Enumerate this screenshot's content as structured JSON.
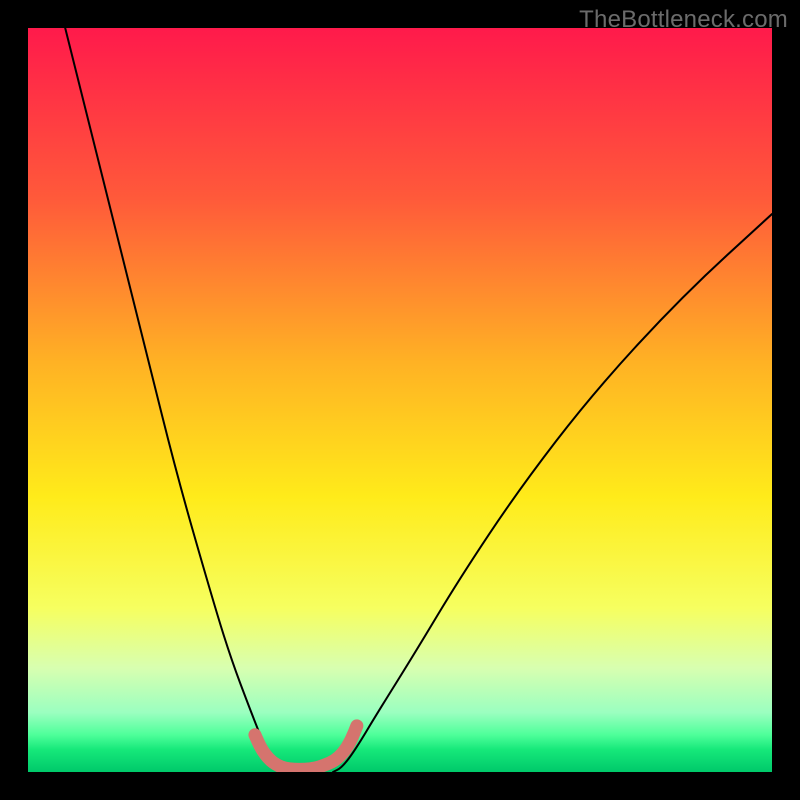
{
  "watermark": "TheBottleneck.com",
  "chart_data": {
    "type": "line",
    "title": "",
    "xlabel": "",
    "ylabel": "",
    "xlim": [
      0,
      100
    ],
    "ylim": [
      0,
      100
    ],
    "grid": false,
    "legend": false,
    "gradient_stops": [
      {
        "offset": 0.0,
        "color": "#ff1a4b"
      },
      {
        "offset": 0.23,
        "color": "#ff5a3a"
      },
      {
        "offset": 0.45,
        "color": "#ffb224"
      },
      {
        "offset": 0.63,
        "color": "#ffeb1a"
      },
      {
        "offset": 0.78,
        "color": "#f6ff60"
      },
      {
        "offset": 0.86,
        "color": "#d8ffb0"
      },
      {
        "offset": 0.92,
        "color": "#9bffc0"
      },
      {
        "offset": 0.95,
        "color": "#4eff9a"
      },
      {
        "offset": 0.97,
        "color": "#16e87a"
      },
      {
        "offset": 1.0,
        "color": "#00c96a"
      }
    ],
    "series": [
      {
        "name": "left-curve",
        "x": [
          5,
          8,
          12,
          16,
          20,
          24,
          27,
          30,
          32,
          33.8,
          35
        ],
        "y": [
          100,
          88,
          72,
          56,
          40,
          26,
          16,
          8,
          3,
          0.7,
          0
        ]
      },
      {
        "name": "right-curve",
        "x": [
          41,
          42.2,
          44,
          47,
          52,
          58,
          66,
          76,
          88,
          100
        ],
        "y": [
          0,
          0.6,
          3,
          8,
          16,
          26,
          38,
          51,
          64,
          75
        ]
      },
      {
        "name": "floor-accent",
        "x": [
          30.5,
          31.4,
          32.5,
          33.5,
          34.5,
          35.8,
          37.2,
          38.6,
          39.8,
          41.2,
          42.4,
          43.4,
          44.2
        ],
        "y": [
          5.0,
          3.0,
          1.6,
          0.9,
          0.5,
          0.35,
          0.35,
          0.5,
          0.9,
          1.5,
          2.6,
          4.2,
          6.2
        ]
      }
    ],
    "accent_color": "#d5746e",
    "curve_color": "#000000"
  }
}
